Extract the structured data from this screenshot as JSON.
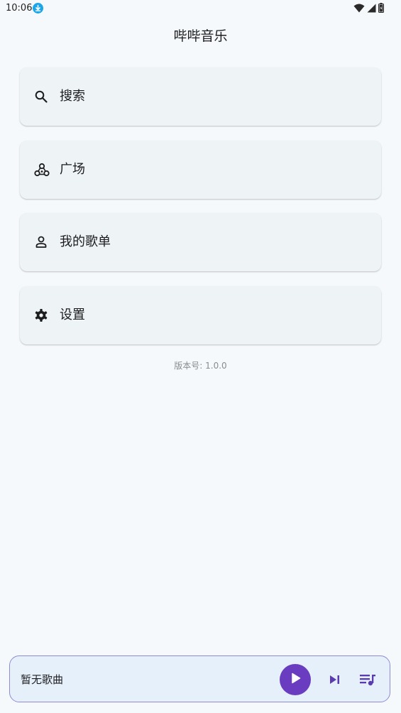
{
  "status_bar": {
    "time": "10:06"
  },
  "app": {
    "title": "哔哔音乐"
  },
  "menu": {
    "items": [
      {
        "label": "搜索",
        "icon": "search-icon"
      },
      {
        "label": "广场",
        "icon": "community-icon"
      },
      {
        "label": "我的歌单",
        "icon": "person-icon"
      },
      {
        "label": "设置",
        "icon": "gear-icon"
      }
    ]
  },
  "version_text": "版本号: 1.0.0",
  "player": {
    "song_title": "暂无歌曲",
    "accent_color": "#6a3dc0",
    "icons": [
      "play-icon",
      "skip-next-icon",
      "queue-music-icon"
    ]
  },
  "colors": {
    "background": "#f6f9fb",
    "card": "#eef3f5",
    "player_bg": "#e6f0fb",
    "player_border": "#8f8bd6",
    "download_badge": "#1aa6e8"
  }
}
